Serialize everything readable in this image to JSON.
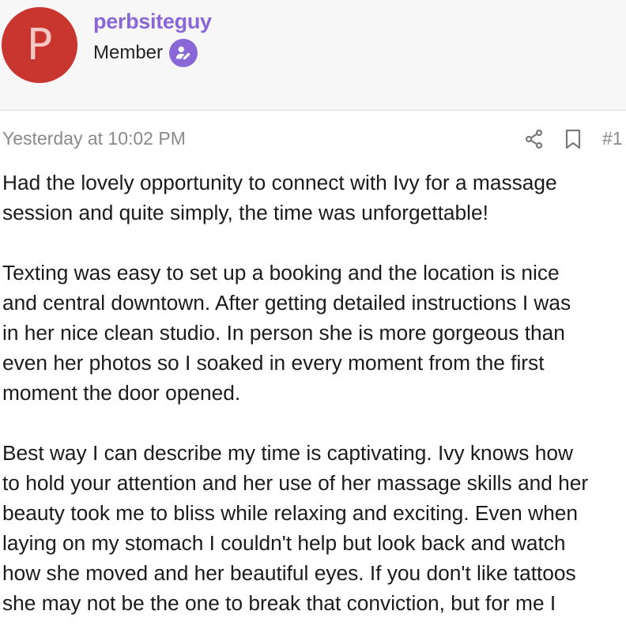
{
  "user": {
    "avatar_letter": "P",
    "avatar_color": "#c9362f",
    "username": "perbsiteguy",
    "username_color": "#8a67d6",
    "title": "Member",
    "badge_icon": "member-badge-icon"
  },
  "post": {
    "timestamp": "Yesterday at 10:02 PM",
    "share_icon": "share-icon",
    "bookmark_icon": "bookmark-icon",
    "number": "#1",
    "paragraphs": [
      "Had the lovely opportunity to connect with Ivy for a massage\nsession and quite simply, the time was unforgettable!",
      "Texting was easy to set up a booking and the location is nice\nand central downtown. After getting detailed instructions I was\nin her nice clean studio. In person she is more gorgeous than\neven her photos so I soaked in every moment from the first\nmoment the door opened.",
      "Best way I can describe my time is captivating. Ivy knows how\nto hold your attention and her use of her massage skills and her\nbeauty took me to bliss while relaxing and exciting. Even when\nlaying on my stomach I couldn't help but look back and watch\nhow she moved and her beautiful eyes. If you don't like tattoos\nshe may not be the one to break that conviction, but for me I"
    ]
  }
}
